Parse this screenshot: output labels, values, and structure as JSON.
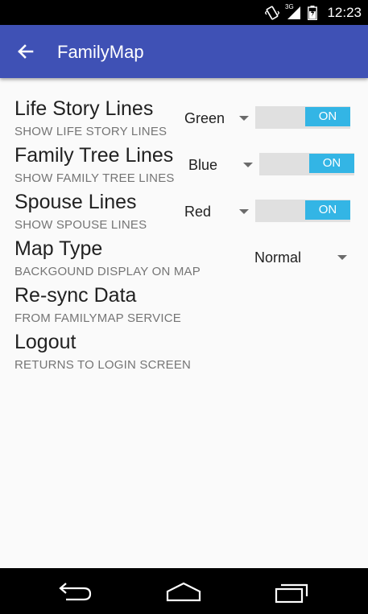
{
  "status_bar": {
    "clock": "12:23",
    "network_label": "3G"
  },
  "app_bar": {
    "title": "FamilyMap"
  },
  "settings": [
    {
      "title": "Life Story Lines",
      "subtitle": "SHOW LIFE STORY LINES",
      "color_value": "Green",
      "switch_label": "ON",
      "switch_on": true
    },
    {
      "title": "Family Tree Lines",
      "subtitle": "SHOW FAMILY TREE LINES",
      "color_value": "Blue",
      "switch_label": "ON",
      "switch_on": true
    },
    {
      "title": "Spouse Lines",
      "subtitle": "SHOW SPOUSE LINES",
      "color_value": "Red",
      "switch_label": "ON",
      "switch_on": true
    },
    {
      "title": "Map Type",
      "subtitle": "BACKGOUND DISPLAY ON MAP",
      "value": "Normal"
    },
    {
      "title": "Re-sync Data",
      "subtitle": "FROM FAMILYMAP SERVICE"
    },
    {
      "title": "Logout",
      "subtitle": "RETURNS TO LOGIN SCREEN"
    }
  ],
  "colors": {
    "app_bar": "#3f51b5",
    "switch_on": "#33b5e5",
    "background": "#fafafa"
  }
}
